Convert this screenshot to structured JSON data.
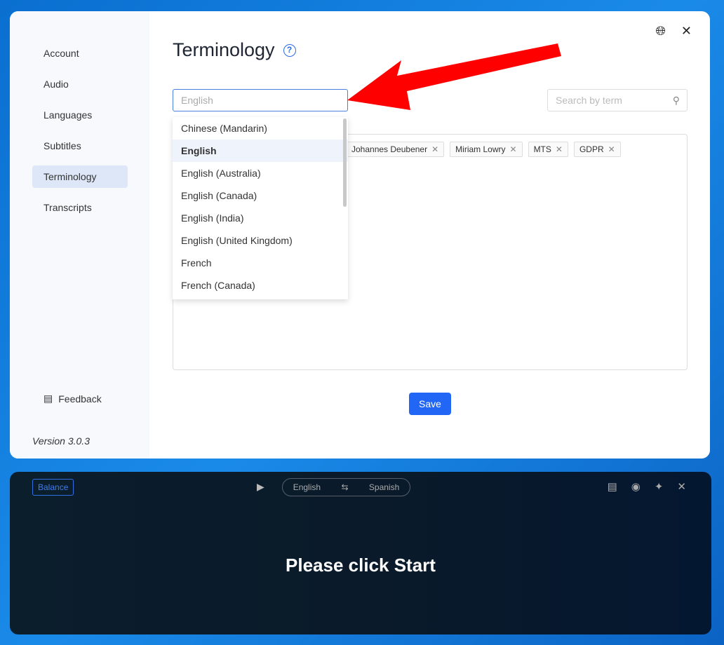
{
  "sidebar": {
    "items": [
      "Account",
      "Audio",
      "Languages",
      "Subtitles",
      "Terminology",
      "Transcripts"
    ],
    "active": "Terminology",
    "feedback": "Feedback",
    "version": "Version 3.0.3"
  },
  "header": {
    "title": "Terminology"
  },
  "language_select": {
    "placeholder": "English",
    "options": [
      "Chinese (Mandarin)",
      "English",
      "English (Australia)",
      "English (Canada)",
      "English (India)",
      "English (United Kingdom)",
      "French",
      "French (Canada)"
    ],
    "highlighted": "English"
  },
  "search": {
    "placeholder": "Search by term"
  },
  "terms": [
    "Johannes Deubener",
    "Miriam Lowry",
    "MTS",
    "GDPR"
  ],
  "save_label": "Save",
  "bar": {
    "balance": "Balance",
    "source_lang": "English",
    "target_lang": "Spanish",
    "message": "Please click Start"
  },
  "colors": {
    "accent": "#2166f5",
    "arrow": "#ff0000"
  }
}
